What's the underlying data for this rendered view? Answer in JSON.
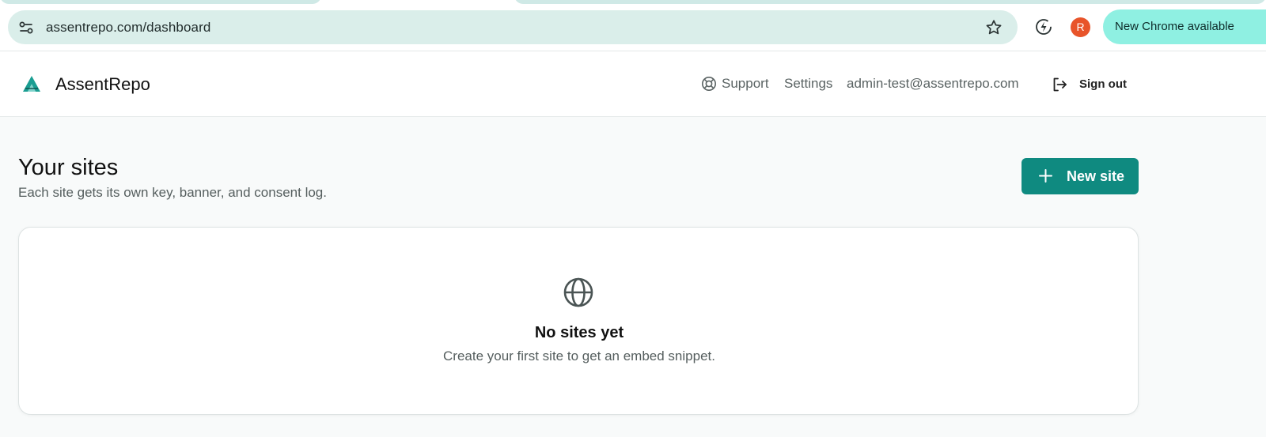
{
  "browser": {
    "url": "assentrepo.com/dashboard",
    "profile_initial": "R",
    "update_label": "New Chrome available"
  },
  "header": {
    "brand": "AssentRepo",
    "nav": {
      "support": "Support",
      "settings": "Settings",
      "email": "admin-test@assentrepo.com",
      "signout": "Sign out"
    }
  },
  "main": {
    "title": "Your sites",
    "subtitle": "Each site gets its own key, banner, and consent log.",
    "new_site_label": "New site",
    "empty_state": {
      "title": "No sites yet",
      "text": "Create your first site to get an embed snippet."
    }
  },
  "colors": {
    "accent": "#0f8a80",
    "omnibox": "#daeeea",
    "update_pill": "#8ff0e2",
    "profile": "#e8542a"
  },
  "icons": [
    "site-info-icon",
    "star-icon",
    "extension-icon",
    "logo-icon",
    "support-icon",
    "sign-out-icon",
    "plus-icon",
    "globe-icon"
  ]
}
